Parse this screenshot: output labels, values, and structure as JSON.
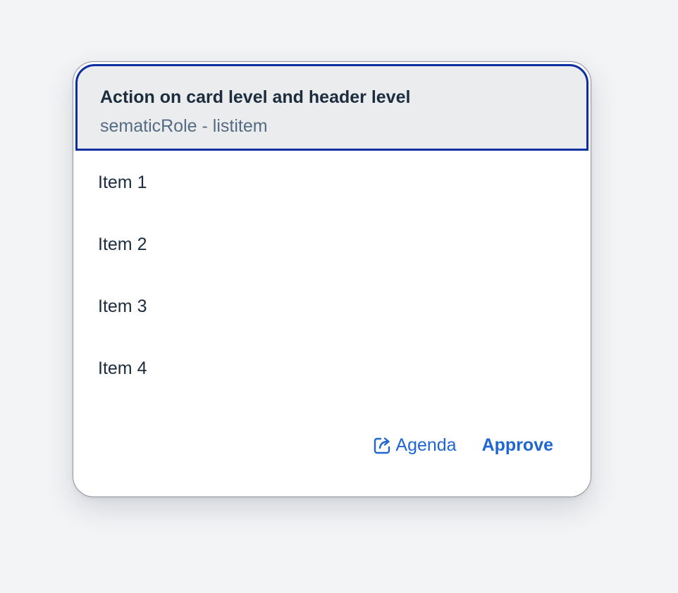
{
  "card": {
    "title": "Action on card level and header level",
    "subtitle": "sematicRole - listitem",
    "items": [
      {
        "label": "Item 1"
      },
      {
        "label": "Item 2"
      },
      {
        "label": "Item 3"
      },
      {
        "label": "Item 4"
      }
    ],
    "actions": {
      "agenda": {
        "label": "Agenda",
        "icon": "external-link-icon"
      },
      "approve": {
        "label": "Approve"
      }
    }
  },
  "colors": {
    "focus_border": "#0b2f9f",
    "link": "#1f66d2",
    "header_bg": "#eaecee",
    "text": "#1d2d3e",
    "subtitle": "#556b82"
  }
}
